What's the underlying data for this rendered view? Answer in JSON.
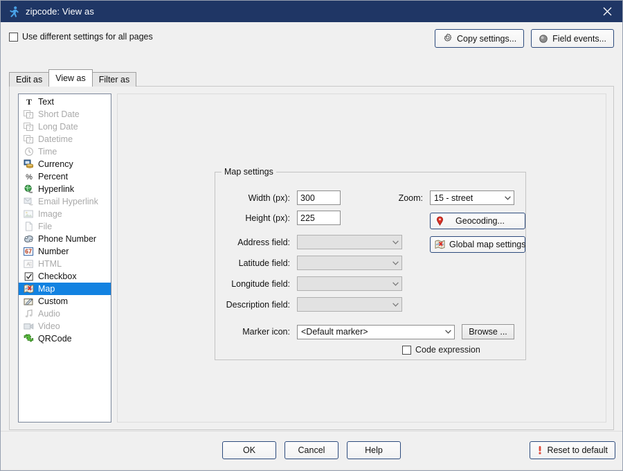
{
  "window": {
    "title": "zipcode: View as",
    "app_icon": "runner-icon",
    "close_icon": "close-icon",
    "titlebar_color": "#1f3665",
    "accent_selection_color": "#1282e1"
  },
  "topbar": {
    "use_different_settings_label": "Use different settings for all pages",
    "use_different_settings_checked": false,
    "copy_settings_label": "Copy settings...",
    "copy_settings_icon": "gear-icon",
    "field_events_label": "Field events...",
    "field_events_icon": "event-sphere-icon"
  },
  "tabs": [
    {
      "label": "Edit as",
      "active": false
    },
    {
      "label": "View as",
      "active": true
    },
    {
      "label": "Filter as",
      "active": false
    }
  ],
  "type_list": [
    {
      "label": "Text",
      "icon": "text-icon",
      "disabled": false,
      "selected": false
    },
    {
      "label": "Short Date",
      "icon": "date-icon",
      "disabled": true,
      "selected": false
    },
    {
      "label": "Long Date",
      "icon": "date-icon",
      "disabled": true,
      "selected": false
    },
    {
      "label": "Datetime",
      "icon": "date-icon",
      "disabled": true,
      "selected": false
    },
    {
      "label": "Time",
      "icon": "clock-icon",
      "disabled": true,
      "selected": false
    },
    {
      "label": "Currency",
      "icon": "currency-icon",
      "disabled": false,
      "selected": false
    },
    {
      "label": "Percent",
      "icon": "percent-icon",
      "disabled": false,
      "selected": false
    },
    {
      "label": "Hyperlink",
      "icon": "globe-icon",
      "disabled": false,
      "selected": false
    },
    {
      "label": "Email Hyperlink",
      "icon": "email-icon",
      "disabled": true,
      "selected": false
    },
    {
      "label": "Image",
      "icon": "image-icon",
      "disabled": true,
      "selected": false
    },
    {
      "label": "File",
      "icon": "file-icon",
      "disabled": true,
      "selected": false
    },
    {
      "label": "Phone Number",
      "icon": "phone-icon",
      "disabled": false,
      "selected": false
    },
    {
      "label": "Number",
      "icon": "number-icon",
      "disabled": false,
      "selected": false
    },
    {
      "label": "HTML",
      "icon": "html-icon",
      "disabled": true,
      "selected": false
    },
    {
      "label": "Checkbox",
      "icon": "checkbox-icon",
      "disabled": false,
      "selected": false
    },
    {
      "label": "Map",
      "icon": "map-icon",
      "disabled": false,
      "selected": true
    },
    {
      "label": "Custom",
      "icon": "custom-icon",
      "disabled": false,
      "selected": false
    },
    {
      "label": "Audio",
      "icon": "audio-icon",
      "disabled": true,
      "selected": false
    },
    {
      "label": "Video",
      "icon": "video-icon",
      "disabled": true,
      "selected": false
    },
    {
      "label": "QRCode",
      "icon": "qrcode-icon",
      "disabled": false,
      "selected": false
    }
  ],
  "map_settings": {
    "group_title": "Map settings",
    "width_label": "Width (px):",
    "width_value": "300",
    "height_label": "Height (px):",
    "height_value": "225",
    "address_label": "Address field:",
    "address_value": "",
    "latitude_label": "Latitude field:",
    "latitude_value": "",
    "longitude_label": "Longitude field:",
    "longitude_value": "",
    "description_label": "Description field:",
    "description_value": "",
    "marker_icon_label": "Marker icon:",
    "marker_icon_value": "<Default marker>",
    "browse_label": "Browse ...",
    "code_expression_label": "Code expression",
    "code_expression_checked": false,
    "zoom_label": "Zoom:",
    "zoom_value": "15 - street",
    "geocoding_label": "Geocoding...",
    "geocoding_icon": "map-pin-icon",
    "global_map_settings_label": "Global map settings",
    "global_map_settings_icon": "map-icon"
  },
  "footer": {
    "ok_label": "OK",
    "cancel_label": "Cancel",
    "help_label": "Help",
    "reset_label": "Reset to default",
    "reset_icon": "exclamation-icon"
  }
}
